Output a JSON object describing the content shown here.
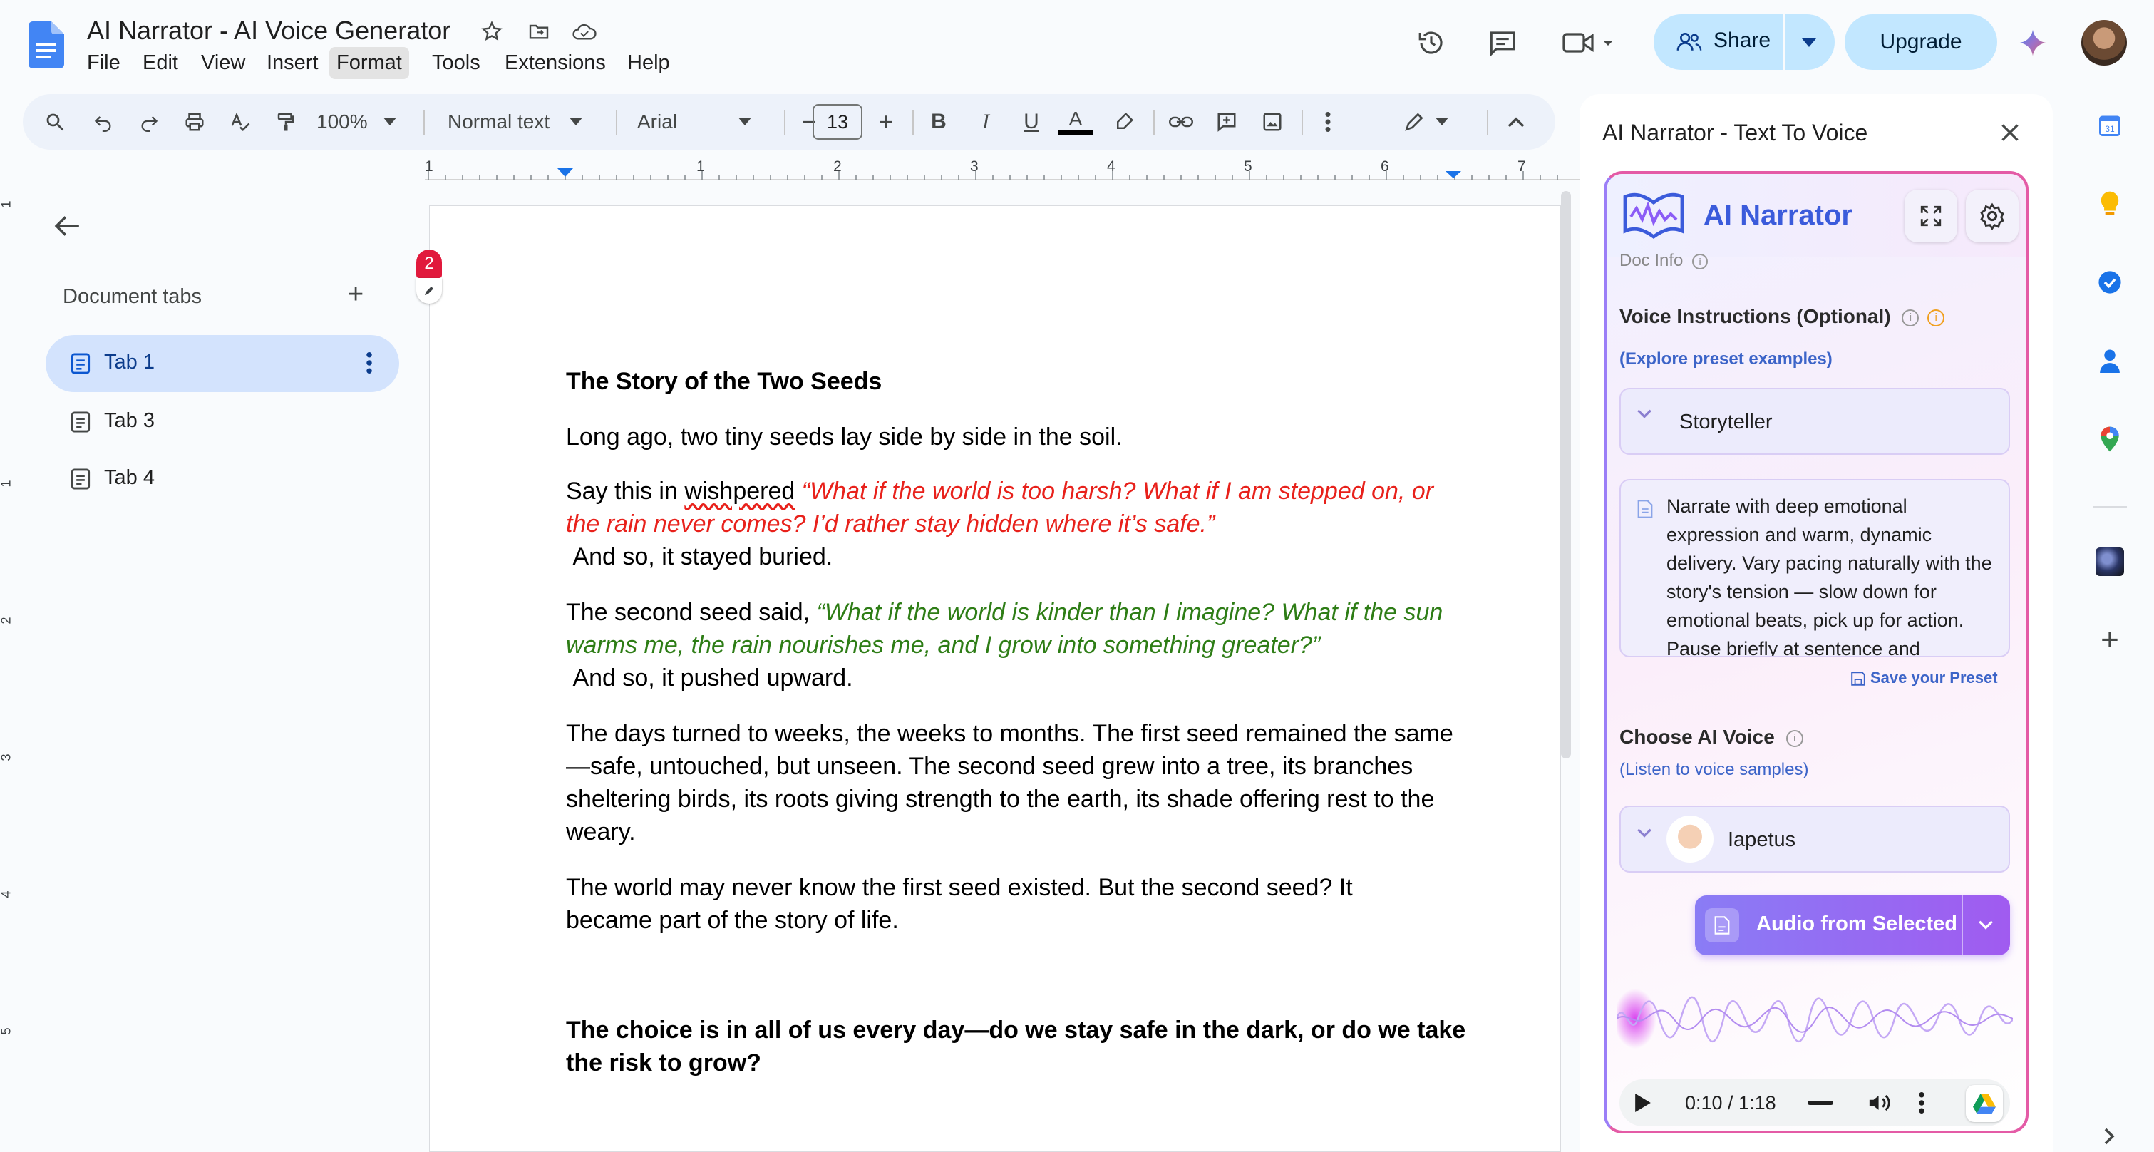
{
  "app": {
    "title": "AI Narrator - AI Voice Generator",
    "menus": [
      "File",
      "Edit",
      "View",
      "Insert",
      "Format",
      "Tools",
      "Extensions",
      "Help"
    ]
  },
  "header": {
    "share_label": "Share",
    "upgrade_label": "Upgrade"
  },
  "toolbar": {
    "zoom": "100%",
    "style": "Normal text",
    "font": "Arial",
    "font_size": "13"
  },
  "ruler_marks": [
    "1",
    "1",
    "2",
    "3",
    "4",
    "5",
    "6",
    "7"
  ],
  "vruler_marks": [
    "1",
    "1",
    "2",
    "3",
    "4",
    "5"
  ],
  "left_panel": {
    "title": "Document tabs",
    "tabs": [
      "Tab 1",
      "Tab 3",
      "Tab 4"
    ],
    "comment_count": "2"
  },
  "document": {
    "title": "The Story of the Two Seeds",
    "p1": "Long ago, two tiny seeds lay side by side in the soil.",
    "p2_prefix": "Say this in ",
    "p2_word": "wishpered",
    "p2_quote": "“What if the world is too harsh? What if I am stepped on, or the rain never comes? I’d rather stay hidden where it’s safe.”",
    "p2_after": "And so, it stayed buried.",
    "p3_prefix": "The second seed said, ",
    "p3_quote": "“What if the world is kinder than I imagine? What if the sun warms me, the rain nourishes me, and I grow into something greater?”",
    "p3_after": "And so, it pushed upward.",
    "p4": "The days turned to weeks, the weeks to months. The first seed remained the same—safe, untouched, but unseen. The second seed grew into a tree, its branches sheltering birds, its roots giving strength to the earth, its shade offering rest to the weary.",
    "p5": "The world may never know the first seed existed. But the second seed? It became part of the story of life.",
    "p6": "The choice is in all of us every day—do we stay safe in the dark, or do we take the risk to grow?"
  },
  "side_panel": {
    "title": "AI Narrator - Text To Voice",
    "brand": "AI Narrator",
    "doc_info": "Doc Info",
    "voice_instructions_label": "Voice Instructions (Optional)",
    "explore_link": "(Explore preset examples)",
    "preset": "Storyteller",
    "instructions_text": "Narrate with deep emotional expression and warm, dynamic delivery. Vary pacing naturally with the story's tension — slow down for emotional beats, pick up for action. Pause briefly at sentence and",
    "save_preset": "Save your Preset",
    "choose_voice_label": "Choose AI Voice",
    "listen_link": "(Listen to voice samples)",
    "voice": "Iapetus",
    "audio_button": "Audio from Selected",
    "player_time": "0:10 / 1:18"
  },
  "colors": {
    "accent": "#0b57d0",
    "share_bg": "#c2e7ff",
    "red_text": "#e8211b",
    "green_text": "#2e7d16",
    "brand_blue": "#3b5bdb",
    "addon_border": "#e45ba6",
    "audio_button": "#8b5cf6"
  }
}
